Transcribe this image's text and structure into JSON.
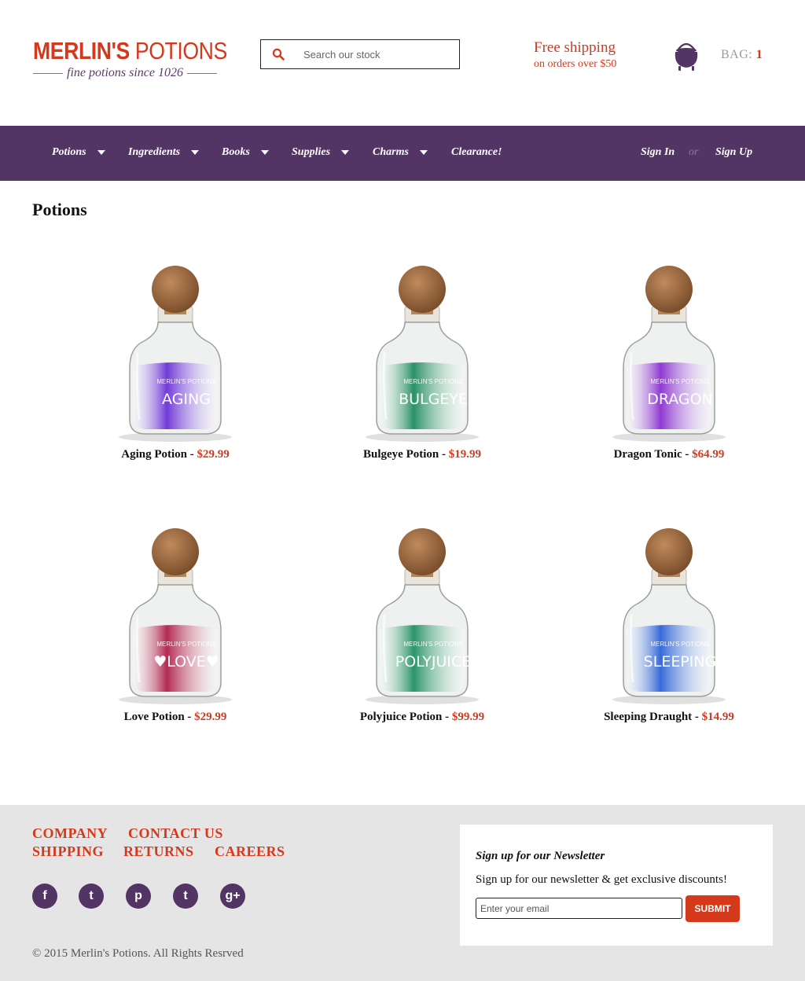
{
  "header": {
    "logo_main_bold": "MERLIN'S",
    "logo_main_light": " POTIONS",
    "logo_tagline": "fine potions since 1026",
    "search_placeholder": "Search our stock",
    "shipping_title": "Free shipping",
    "shipping_sub": "on orders over $50",
    "bag_label": "BAG:",
    "bag_count": "1"
  },
  "nav": {
    "items": [
      "Potions",
      "Ingredients",
      "Books",
      "Supplies",
      "Charms",
      "Clearance!"
    ],
    "sign_in": "Sign In",
    "or": "or",
    "sign_up": "Sign Up"
  },
  "main": {
    "title": "Potions",
    "products": [
      {
        "name": "Aging Potion",
        "price": "$29.99",
        "label": "AGING",
        "color": "#6a2fd6"
      },
      {
        "name": "Bulgeye Potion",
        "price": "$19.99",
        "label": "BULGEYE",
        "color": "#1f8c5c"
      },
      {
        "name": "Dragon Tonic",
        "price": "$64.99",
        "label": "DRAGON",
        "color": "#8a2fd0"
      },
      {
        "name": "Love Potion",
        "price": "$29.99",
        "label": "♥LOVE♥",
        "color": "#b01f4a"
      },
      {
        "name": "Polyjuice Potion",
        "price": "$99.99",
        "label": "POLYJUICE",
        "color": "#1f9060"
      },
      {
        "name": "Sleeping Draught",
        "price": "$14.99",
        "label": "SLEEPING",
        "color": "#2c62d6"
      }
    ],
    "bottle_brand": "MERLIN'S POTIONS"
  },
  "footer": {
    "links": [
      "COMPANY",
      "CONTACT US",
      "SHIPPING",
      "RETURNS",
      "CAREERS"
    ],
    "social": [
      "f",
      "t",
      "p",
      "t",
      "g+"
    ],
    "social_names": [
      "facebook-icon",
      "twitter-icon",
      "pinterest-icon",
      "tumblr-icon",
      "google-plus-icon"
    ],
    "copyright": "© 2015 Merlin's Potions. All Rights Resrved",
    "newsletter_title": "Sign up for our Newsletter",
    "newsletter_text": "Sign up for our newsletter & get exclusive discounts!",
    "email_placeholder": "Enter your email",
    "submit": "SUBMIT"
  },
  "colors": {
    "accent": "#d4391c",
    "nav": "#523465",
    "footer_bg": "#e5e5e5"
  }
}
